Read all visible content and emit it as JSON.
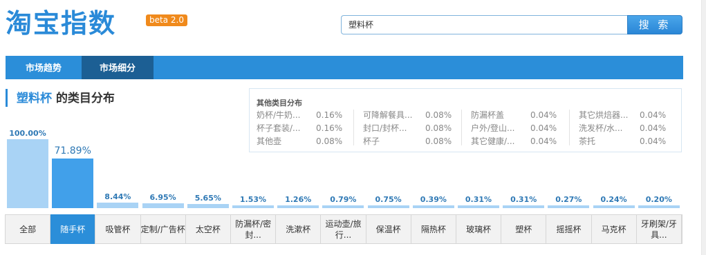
{
  "header": {
    "logo": "淘宝指数",
    "beta": "beta 2.0",
    "search_value": "塑料杯",
    "search_button": "搜 索"
  },
  "nav": {
    "tabs": [
      "市场趋势",
      "市场细分"
    ],
    "active": 1
  },
  "section": {
    "keyword": "塑料杯",
    "suffix": " 的类目分布"
  },
  "others": {
    "title": "其他类目分布",
    "items": [
      {
        "name": "奶杯/牛奶...",
        "value": "0.16%"
      },
      {
        "name": "杯子套装/...",
        "value": "0.16%"
      },
      {
        "name": "其他壶",
        "value": "0.08%"
      },
      {
        "name": "可降解餐具...",
        "value": "0.08%"
      },
      {
        "name": "封口/封杯...",
        "value": "0.08%"
      },
      {
        "name": "杯子",
        "value": "0.08%"
      },
      {
        "name": "防漏杯盖",
        "value": "0.04%"
      },
      {
        "name": "户外/登山...",
        "value": "0.04%"
      },
      {
        "name": "其它健康/...",
        "value": "0.04%"
      },
      {
        "name": "其它烘焙器...",
        "value": "0.04%"
      },
      {
        "name": "洗发杯/水...",
        "value": "0.04%"
      },
      {
        "name": "茶托",
        "value": "0.04%"
      }
    ]
  },
  "chart_data": {
    "type": "bar",
    "categories": [
      "全部",
      "随手杯",
      "吸管杯",
      "定制/广告杯",
      "太空杯",
      "防漏杯/密封...",
      "洗漱杯",
      "运动壶/旅行...",
      "保温杯",
      "隔热杯",
      "玻璃杯",
      "塑杯",
      "摇摇杯",
      "马克杯",
      "牙刷架/牙具..."
    ],
    "values": [
      100.0,
      71.89,
      8.44,
      6.95,
      5.65,
      1.53,
      1.26,
      0.79,
      0.75,
      0.39,
      0.31,
      0.31,
      0.27,
      0.24,
      0.2
    ],
    "labels": [
      "100.00%",
      "71.89%",
      "8.44%",
      "6.95%",
      "5.65%",
      "1.53%",
      "1.26%",
      "0.79%",
      "0.75%",
      "0.39%",
      "0.31%",
      "0.31%",
      "0.27%",
      "0.24%",
      "0.20%"
    ],
    "selected": 1,
    "colors": {
      "bar": "#a9d3f5",
      "selected": "#41a0ea"
    }
  }
}
